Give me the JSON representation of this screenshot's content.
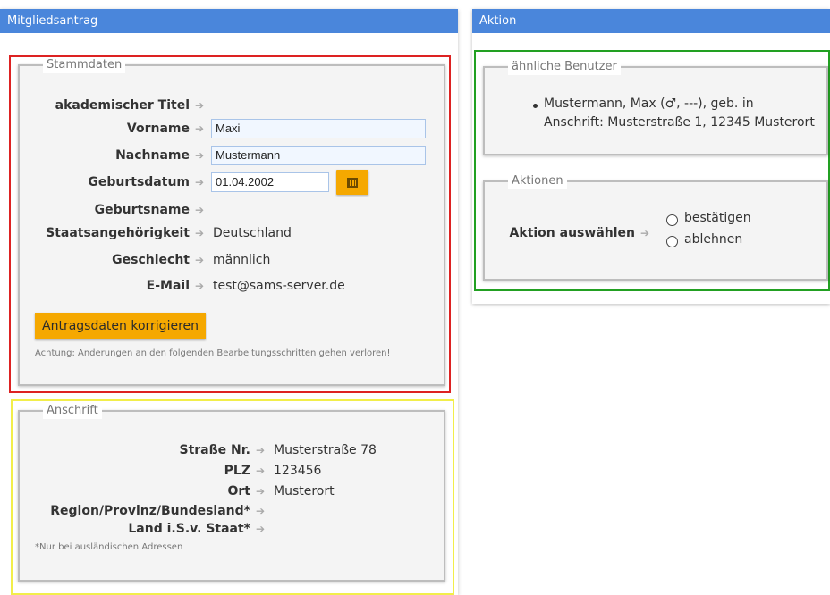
{
  "left_panel": {
    "title": "Mitgliedsantrag"
  },
  "right_panel": {
    "title": "Aktion"
  },
  "stammdaten": {
    "legend": "Stammdaten",
    "arrow": "➔",
    "fields": {
      "titel": {
        "label": "akademischer Titel",
        "value": ""
      },
      "vorname": {
        "label": "Vorname",
        "value": "Maxi"
      },
      "nachname": {
        "label": "Nachname",
        "value": "Mustermann"
      },
      "geburtsdatum": {
        "label": "Geburtsdatum",
        "value": "01.04.2002"
      },
      "geburtsname": {
        "label": "Geburtsname",
        "value": ""
      },
      "staat": {
        "label": "Staatsangehörigkeit",
        "value": "Deutschland"
      },
      "geschlecht": {
        "label": "Geschlecht",
        "value": "männlich"
      },
      "email": {
        "label": "E-Mail",
        "value": "test@sams-server.de"
      }
    },
    "correct_button": "Antragsdaten korrigieren",
    "warning": "Achtung: Änderungen an den folgenden Bearbeitungsschritten gehen verloren!"
  },
  "anschrift": {
    "legend": "Anschrift",
    "fields": {
      "strasse": {
        "label": "Straße Nr.",
        "value": "Musterstraße 78"
      },
      "plz": {
        "label": "PLZ",
        "value": "123456"
      },
      "ort": {
        "label": "Ort",
        "value": "Musterort"
      },
      "region": {
        "label": "Region/Provinz/Bundesland*",
        "value": ""
      },
      "land": {
        "label": "Land i.S.v. Staat*",
        "value": ""
      }
    },
    "footnote": "*Nur bei ausländischen Adressen"
  },
  "aehnliche_benutzer": {
    "legend": "ähnliche Benutzer",
    "items": [
      {
        "line1": "Mustermann, Max (♂, ---), geb. in",
        "line2": "Anschrift: Musterstraße 1, 12345 Musterort"
      }
    ]
  },
  "aktionen": {
    "legend": "Aktionen",
    "label": "Aktion auswählen",
    "options": [
      "bestätigen",
      "ablehnen"
    ]
  },
  "highlight_colors": {
    "red": "#dd2222",
    "yellow": "#f2ee4a",
    "green": "#22a022"
  },
  "accent_color": "#4a86db",
  "button_color": "#f5a800"
}
